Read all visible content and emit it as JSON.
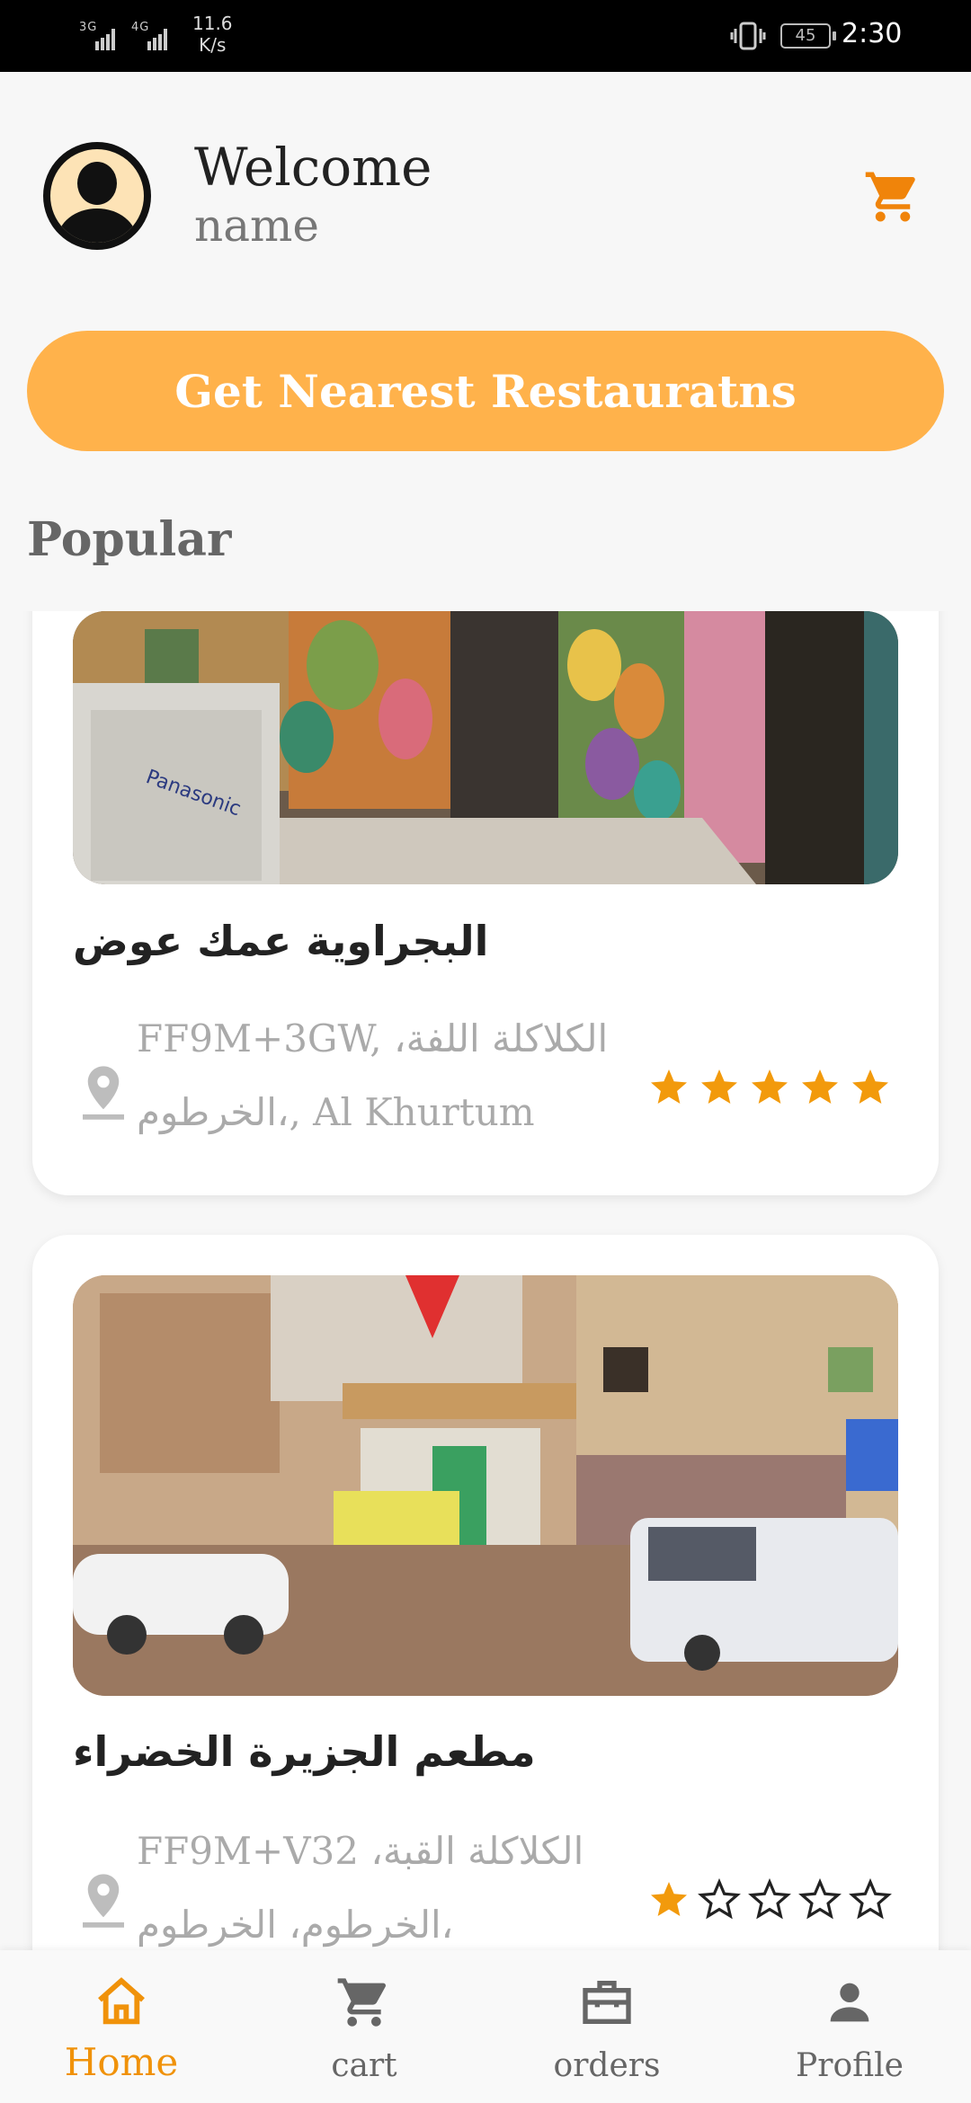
{
  "status_bar": {
    "signal": "3G 4G",
    "speed_value": "11.6",
    "speed_unit": "K/s",
    "battery": "45",
    "time": "2:30"
  },
  "header": {
    "welcome": "Welcome",
    "username": "name",
    "cart_icon": "cart-icon"
  },
  "nearest_button": "Get Nearest Restauratns",
  "section_title": "Popular",
  "restaurants": [
    {
      "name": "البجراوية عمك عوض",
      "address": "FF9M+3GW, الكلاكلة اللفة، الخرطوم،, Al Khurtum",
      "rating": 5
    },
    {
      "name": "مطعم الجزيرة الخضراء",
      "address": "FF9M+V32 الكلاكلة القبة، الخرطوم، الخرطوم،",
      "rating": 1
    }
  ],
  "nav": {
    "items": [
      {
        "label": "Home",
        "icon": "home-icon",
        "active": true
      },
      {
        "label": "cart",
        "icon": "cart-icon",
        "active": false
      },
      {
        "label": "orders",
        "icon": "briefcase-icon",
        "active": false
      },
      {
        "label": "Profile",
        "icon": "person-icon",
        "active": false
      }
    ]
  },
  "colors": {
    "accent": "#ffb24b",
    "accent_dark": "#f0920a",
    "star": "#f29a0c"
  }
}
